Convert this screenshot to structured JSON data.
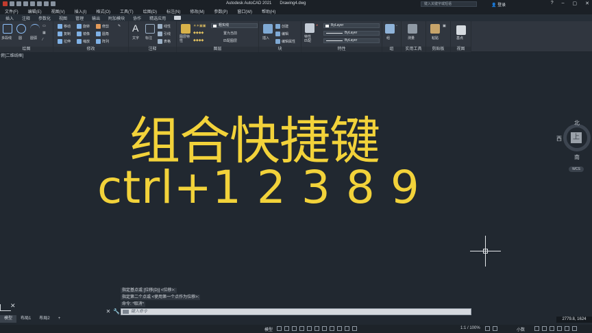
{
  "app": {
    "title": "Autodesk AutoCAD 2021",
    "file": "Drawing4.dwg"
  },
  "search": {
    "placeholder": "键入关键字或短语"
  },
  "user": {
    "label": "登录"
  },
  "menu": [
    "文件(F)",
    "编辑(E)",
    "视图(V)",
    "插入(I)",
    "格式(O)",
    "工具(T)",
    "绘图(D)",
    "标注(N)",
    "修改(M)",
    "参数(P)",
    "窗口(W)",
    "帮助(H)"
  ],
  "tabs": [
    "插入",
    "注释",
    "参数化",
    "视图",
    "管理",
    "输出",
    "附加模块",
    "协作",
    "精选应用"
  ],
  "ribbon": {
    "draw": {
      "title": "绘图",
      "polyline": "多段线",
      "circle": "圆",
      "arc": "圆弧"
    },
    "modify": {
      "title": "修改",
      "move": "移动",
      "rotate": "旋转",
      "trim": "修剪",
      "copy": "复制",
      "mirror": "镜像",
      "fillet": "圆角",
      "stretch": "拉伸",
      "scale": "缩放",
      "array": "阵列"
    },
    "annotation": {
      "title": "注释",
      "text": "文字",
      "dim": "标注",
      "linear": "线性",
      "leader": "引线",
      "table": "表格"
    },
    "layers": {
      "title": "图层",
      "props": "图层特性",
      "layer_name": "粗实线",
      "make_current": "置为当前",
      "match": "匹配图层"
    },
    "block": {
      "title": "块",
      "insert": "插入",
      "create": "创建",
      "edit": "编辑",
      "edit_attr": "编辑属性"
    },
    "properties": {
      "title": "特性",
      "match": "特性匹配",
      "color": "ByLayer",
      "linetype": "ByLayer",
      "lineweight": "ByLayer"
    },
    "groups": {
      "title": "组",
      "group": "组"
    },
    "utilities": {
      "title": "实用工具",
      "measure": "测量"
    },
    "clipboard": {
      "title": "剪贴板",
      "paste": "粘贴"
    },
    "view": {
      "title": "视图",
      "base": "基点"
    }
  },
  "filetab": {
    "label": "俯]二维线框]"
  },
  "canvas": {
    "line1": "组合快捷键",
    "line2": "ctrl+1  2  3   8  9"
  },
  "viewcube": {
    "north": "北",
    "west": "西",
    "south": "南",
    "top": "上",
    "wcs": "WCS"
  },
  "command": {
    "history": [
      "指定基点或 [位移(D)] <位移>:",
      "指定第二个点或 <使用第一个点作为位移>:",
      "命令: *取消*"
    ],
    "placeholder": "键入命令"
  },
  "layouts": [
    "模型",
    "布局1",
    "布局2"
  ],
  "coords": "2779.8, 1624",
  "status": {
    "model": "模型",
    "scale": "1:1 / 100%",
    "units": "小数"
  }
}
